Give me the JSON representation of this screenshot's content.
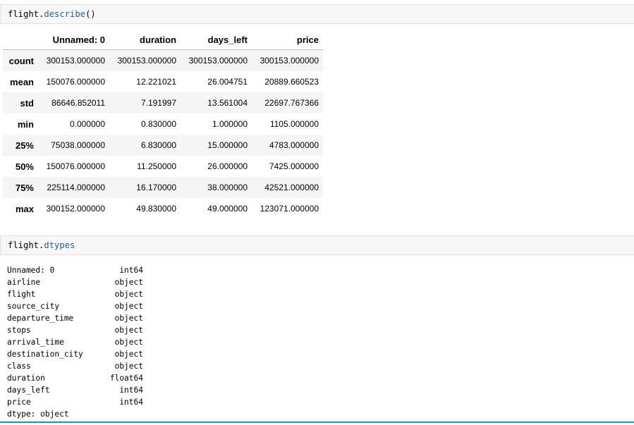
{
  "cells": [
    {
      "code": {
        "object": "flight",
        "dot": ".",
        "method": "describe",
        "parens": "()"
      }
    },
    {
      "code": {
        "object": "flight",
        "dot": ".",
        "method": "dtypes",
        "parens": ""
      }
    }
  ],
  "describe_table": {
    "columns": [
      "",
      "Unnamed: 0",
      "duration",
      "days_left",
      "price"
    ],
    "rows": [
      {
        "label": "count",
        "values": [
          "300153.000000",
          "300153.000000",
          "300153.000000",
          "300153.000000"
        ]
      },
      {
        "label": "mean",
        "values": [
          "150076.000000",
          "12.221021",
          "26.004751",
          "20889.660523"
        ]
      },
      {
        "label": "std",
        "values": [
          "86646.852011",
          "7.191997",
          "13.561004",
          "22697.767366"
        ]
      },
      {
        "label": "min",
        "values": [
          "0.000000",
          "0.830000",
          "1.000000",
          "1105.000000"
        ]
      },
      {
        "label": "25%",
        "values": [
          "75038.000000",
          "6.830000",
          "15.000000",
          "4783.000000"
        ]
      },
      {
        "label": "50%",
        "values": [
          "150076.000000",
          "11.250000",
          "26.000000",
          "7425.000000"
        ]
      },
      {
        "label": "75%",
        "values": [
          "225114.000000",
          "16.170000",
          "38.000000",
          "42521.000000"
        ]
      },
      {
        "label": "max",
        "values": [
          "300152.000000",
          "49.830000",
          "49.000000",
          "123071.000000"
        ]
      }
    ]
  },
  "dtypes_output": {
    "items": [
      {
        "name": "Unnamed: 0",
        "dtype": "int64"
      },
      {
        "name": "airline",
        "dtype": "object"
      },
      {
        "name": "flight",
        "dtype": "object"
      },
      {
        "name": "source_city",
        "dtype": "object"
      },
      {
        "name": "departure_time",
        "dtype": "object"
      },
      {
        "name": "stops",
        "dtype": "object"
      },
      {
        "name": "arrival_time",
        "dtype": "object"
      },
      {
        "name": "destination_city",
        "dtype": "object"
      },
      {
        "name": "class",
        "dtype": "object"
      },
      {
        "name": "duration",
        "dtype": "float64"
      },
      {
        "name": "days_left",
        "dtype": "int64"
      },
      {
        "name": "price",
        "dtype": "int64"
      }
    ],
    "footer": "dtype: object"
  },
  "colors": {
    "method": "#2a5d9f",
    "cell_bg": "#f7f7f7",
    "selection_bar": "#1f8ec2"
  }
}
